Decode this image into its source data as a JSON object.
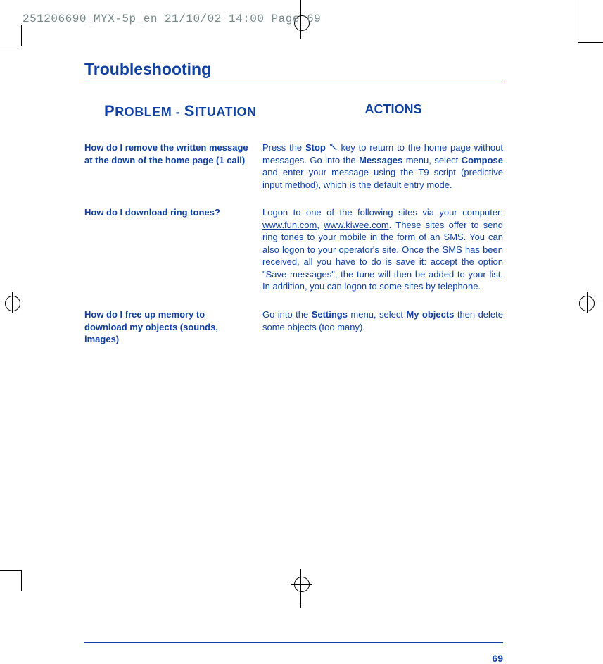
{
  "print_header": "251206690_MYX-5p_en  21/10/02  14:00  Page 69",
  "title": "Troubleshooting",
  "col_left_head": "Problem - Situation",
  "col_right_head": "ACTIONS",
  "rows": [
    {
      "problem": "How do I remove the written message at the down of the home page (1 call)",
      "action": "Press the <b>Stop</b> <svg class='stop-icon' viewBox='0 0 20 20'><path d='M3 3 L17 17 M3 3 L3 8 M3 3 L8 3' stroke='#1040a0' stroke-width='2' fill='none'/></svg> key to return to the home page without messages. Go into the <b>Messages</b> menu, select <b>Compose</b> and enter your message using the T9 script (predictive input method), which is the default entry mode."
    },
    {
      "problem": "How do I download ring tones?",
      "action": "Logon to one of the following sites via your computer: <span class='u'>www.fun.com</span>, <span class='u'>www.kiwee.com</span>. These sites offer to send ring tones to your mobile in the form of an SMS. You can also logon to your operator's site. Once the SMS has been received, all you have to do is save it: accept the option \"Save messages\", the tune will then be added to your list. In addition, you can logon to some sites by telephone."
    },
    {
      "problem": "How do I free up memory to download my objects (sounds, images)",
      "action": "Go into the <b>Settings</b> menu, select <b>My objects</b> then delete some objects (too many)."
    }
  ],
  "page_number": "69"
}
